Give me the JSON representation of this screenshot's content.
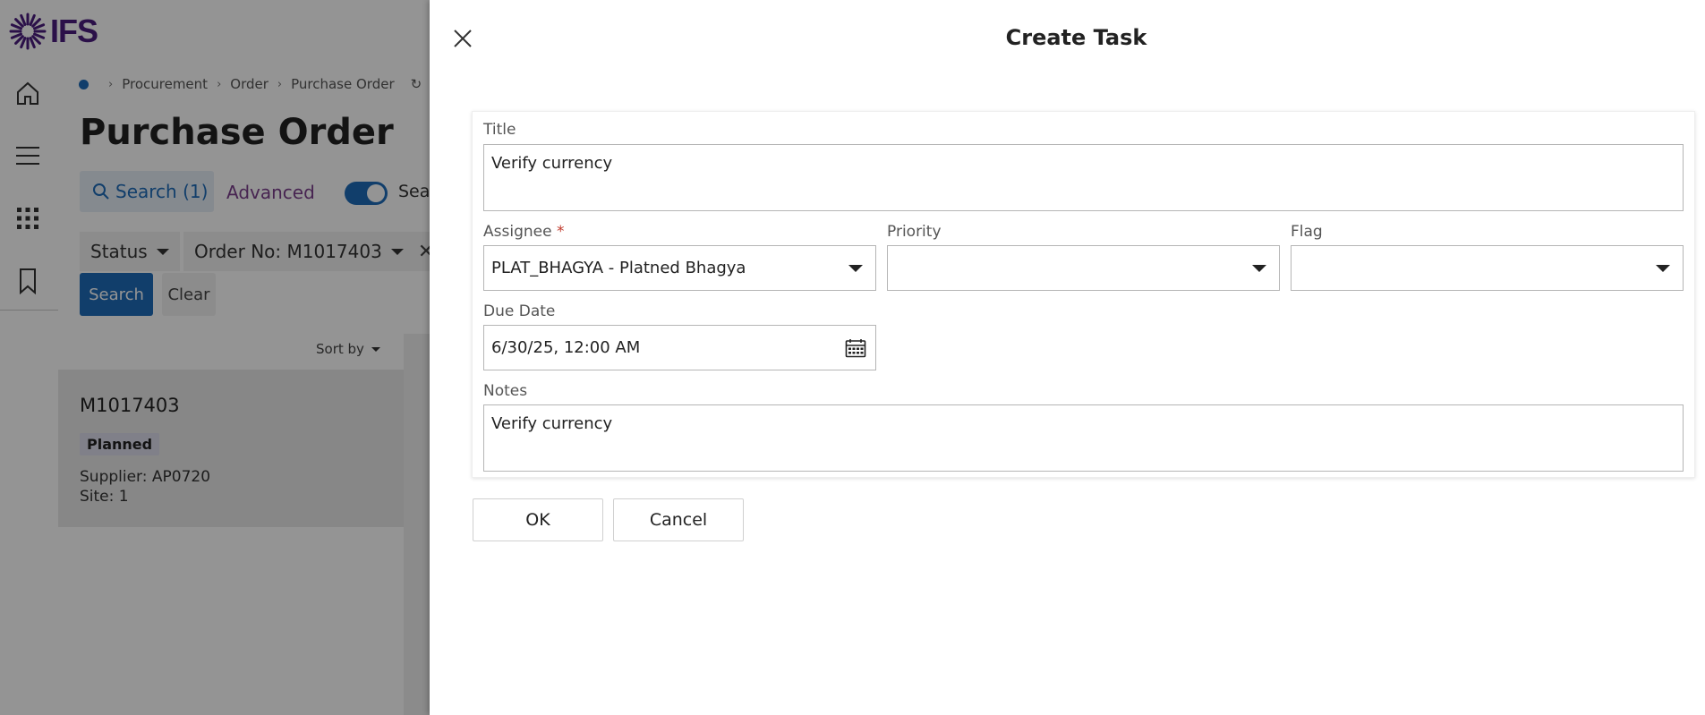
{
  "app": {
    "logo_text": "IFS",
    "breadcrumb": [
      "Procurement",
      "Order",
      "Purchase Order"
    ],
    "page_title": "Purchase Order",
    "search_tab_label": "Search (1)",
    "advanced_label": "Advanced",
    "toggle_label": "Sea",
    "filters": {
      "status_label": "Status",
      "order_label": "Order No: M1017403"
    },
    "search_button": "Search",
    "clear_button": "Clear",
    "sort_by": "Sort by",
    "card": {
      "id": "M1017403",
      "status": "Planned",
      "supplier": "Supplier:   AP0720",
      "site": "Site:   1"
    }
  },
  "dialog": {
    "title": "Create Task",
    "fields": {
      "title_label": "Title",
      "title_value": "Verify currency",
      "assignee_label": "Assignee",
      "assignee_required": "*",
      "assignee_value": "PLAT_BHAGYA - Platned Bhagya",
      "priority_label": "Priority",
      "priority_value": "",
      "flag_label": "Flag",
      "flag_value": "",
      "due_date_label": "Due Date",
      "due_date_value": "6/30/25, 12:00 AM",
      "notes_label": "Notes",
      "notes_value": "Verify currency"
    },
    "ok_label": "OK",
    "cancel_label": "Cancel"
  },
  "colors": {
    "brand_purple": "#4b1d7e",
    "accent_blue": "#1e6bb8",
    "required_red": "#c0392b"
  }
}
